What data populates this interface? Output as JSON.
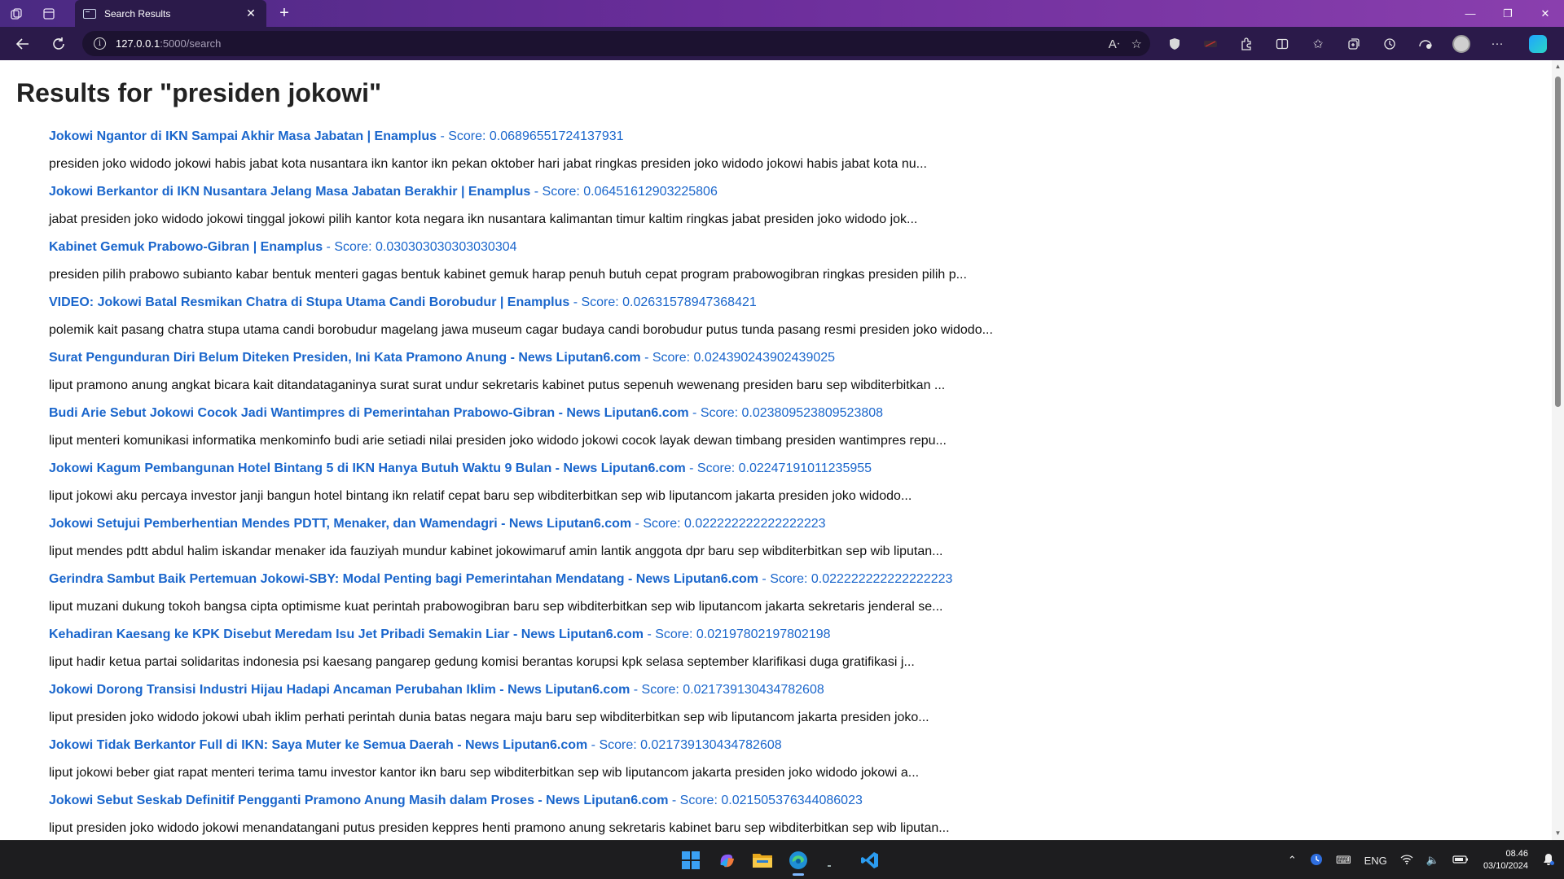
{
  "browser": {
    "tab_title": "Search Results",
    "url_host": "127.0.0.1",
    "url_path": ":5000/search"
  },
  "page": {
    "heading": "Results for \"presiden jokowi\"",
    "score_prefix": " - Score: ",
    "results": [
      {
        "title": "Jokowi Ngantor di IKN Sampai Akhir Masa Jabatan | Enamplus",
        "score": "0.06896551724137931",
        "snippet": "presiden joko widodo jokowi habis jabat kota nusantara ikn kantor ikn pekan oktober hari jabat ringkas presiden joko widodo jokowi habis jabat kota nu..."
      },
      {
        "title": "Jokowi Berkantor di IKN Nusantara Jelang Masa Jabatan Berakhir | Enamplus",
        "score": "0.06451612903225806",
        "snippet": "jabat presiden joko widodo jokowi tinggal jokowi pilih kantor kota negara ikn nusantara kalimantan timur kaltim ringkas jabat presiden joko widodo jok..."
      },
      {
        "title": "Kabinet Gemuk Prabowo-Gibran | Enamplus",
        "score": "0.030303030303030304",
        "snippet": "presiden pilih prabowo subianto kabar bentuk menteri gagas bentuk kabinet gemuk harap penuh butuh cepat program prabowogibran ringkas presiden pilih p..."
      },
      {
        "title": "VIDEO: Jokowi Batal Resmikan Chatra di Stupa Utama Candi Borobudur | Enamplus",
        "score": "0.02631578947368421",
        "snippet": "polemik kait pasang chatra stupa utama candi borobudur magelang jawa museum cagar budaya candi borobudur putus tunda pasang resmi presiden joko widodo..."
      },
      {
        "title": "Surat Pengunduran Diri Belum Diteken Presiden, Ini Kata Pramono Anung - News Liputan6.com",
        "score": "0.024390243902439025",
        "snippet": "liput pramono anung angkat bicara kait ditandataganinya surat surat undur sekretaris kabinet putus sepenuh wewenang presiden baru sep wibditerbitkan ..."
      },
      {
        "title": "Budi Arie Sebut Jokowi Cocok Jadi Wantimpres di Pemerintahan Prabowo-Gibran - News Liputan6.com",
        "score": "0.023809523809523808",
        "snippet": "liput menteri komunikasi informatika menkominfo budi arie setiadi nilai presiden joko widodo jokowi cocok layak dewan timbang presiden wantimpres repu..."
      },
      {
        "title": "Jokowi Kagum Pembangunan Hotel Bintang 5 di IKN Hanya Butuh Waktu 9 Bulan - News Liputan6.com",
        "score": "0.02247191011235955",
        "snippet": "liput jokowi aku percaya investor janji bangun hotel bintang ikn relatif cepat baru sep wibditerbitkan sep wib liputancom jakarta presiden joko widodo..."
      },
      {
        "title": "Jokowi Setujui Pemberhentian Mendes PDTT, Menaker, dan Wamendagri - News Liputan6.com",
        "score": "0.022222222222222223",
        "snippet": "liput mendes pdtt abdul halim iskandar menaker ida fauziyah mundur kabinet jokowimaruf amin lantik anggota dpr baru sep wibditerbitkan sep wib liputan..."
      },
      {
        "title": "Gerindra Sambut Baik Pertemuan Jokowi-SBY: Modal Penting bagi Pemerintahan Mendatang - News Liputan6.com",
        "score": "0.022222222222222223",
        "snippet": "liput muzani dukung tokoh bangsa cipta optimisme kuat perintah prabowogibran baru sep wibditerbitkan sep wib liputancom jakarta sekretaris jenderal se..."
      },
      {
        "title": "Kehadiran Kaesang ke KPK Disebut Meredam Isu Jet Pribadi Semakin Liar - News Liputan6.com",
        "score": "0.02197802197802198",
        "snippet": "liput hadir ketua partai solidaritas indonesia psi kaesang pangarep gedung komisi berantas korupsi kpk selasa september klarifikasi duga gratifikasi j..."
      },
      {
        "title": "Jokowi Dorong Transisi Industri Hijau Hadapi Ancaman Perubahan Iklim - News Liputan6.com",
        "score": "0.021739130434782608",
        "snippet": "liput presiden joko widodo jokowi ubah iklim perhati perintah dunia batas negara maju baru sep wibditerbitkan sep wib liputancom jakarta presiden joko..."
      },
      {
        "title": "Jokowi Tidak Berkantor Full di IKN: Saya Muter ke Semua Daerah - News Liputan6.com",
        "score": "0.021739130434782608",
        "snippet": "liput jokowi beber giat rapat menteri terima tamu investor kantor ikn baru sep wibditerbitkan sep wib liputancom jakarta presiden joko widodo jokowi a..."
      },
      {
        "title": "Jokowi Sebut Seskab Definitif Pengganti Pramono Anung Masih dalam Proses - News Liputan6.com",
        "score": "0.021505376344086023",
        "snippet": "liput presiden joko widodo jokowi menandatangani putus presiden keppres henti pramono anung sekretaris kabinet baru sep wibditerbitkan sep wib liputan..."
      }
    ]
  },
  "taskbar": {
    "lang": "ENG",
    "time": "08.46",
    "date": "03/10/2024"
  },
  "icons": [
    "workspaces-icon",
    "tab-actions-icon",
    "back-icon",
    "refresh-icon",
    "info-icon",
    "read-aloud-icon",
    "favorite-star-icon",
    "shield-icon",
    "extension-icon",
    "split-screen-icon",
    "favorites-icon",
    "collections-icon",
    "history-icon",
    "performance-icon",
    "profile-avatar",
    "more-icon",
    "copilot-icon",
    "windows-start-icon",
    "wifi-icon",
    "volume-icon",
    "battery-icon",
    "bell-icon"
  ]
}
